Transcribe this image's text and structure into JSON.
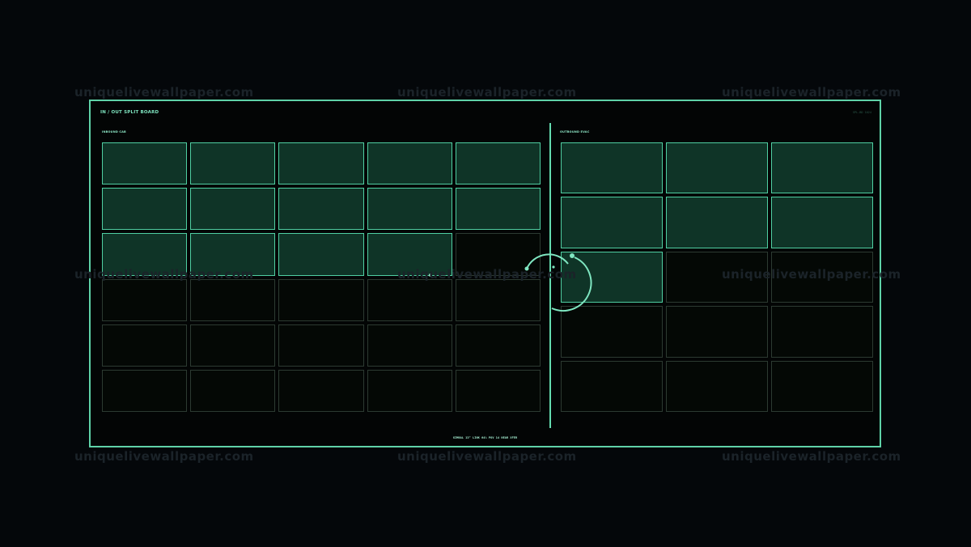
{
  "board": {
    "title": "IN / OUT SPLIT BOARD",
    "tag": "SPL-BD 1024"
  },
  "inbound": {
    "label": "INBOUND CAB",
    "columns": 5,
    "rows": 6,
    "active_count": 14
  },
  "outbound": {
    "label": "OUTBOUND EVAC",
    "columns": 3,
    "rows": 5,
    "active_count": 7
  },
  "status_line": "GIMBAL 13°  LINK 64%  POV 14  NEAR XFER",
  "colors": {
    "accent": "#5fd2a8",
    "active_fill": "#0f3427",
    "inactive_border": "#2c3a31",
    "background": "#04070a"
  },
  "watermark": "uniquelivewallpaper.com"
}
